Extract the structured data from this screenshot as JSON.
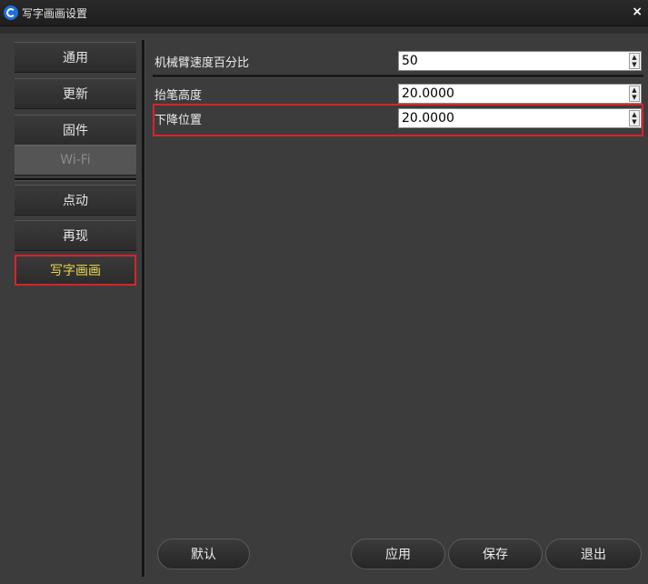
{
  "window": {
    "title": "写字画画设置",
    "close_label": "×"
  },
  "sidebar": {
    "items": [
      {
        "label": "通用",
        "state": "normal"
      },
      {
        "label": "更新",
        "state": "normal"
      },
      {
        "label": "固件",
        "state": "normal"
      },
      {
        "label": "Wi-Fi",
        "state": "disabled"
      },
      {
        "label": "点动",
        "state": "normal"
      },
      {
        "label": "再现",
        "state": "normal"
      },
      {
        "label": "写字画画",
        "state": "active"
      }
    ]
  },
  "settings": {
    "rows": [
      {
        "label": "机械臂速度百分比",
        "value": "50"
      },
      {
        "label": "抬笔高度",
        "value": "20.0000"
      },
      {
        "label": "下降位置",
        "value": "20.0000"
      }
    ]
  },
  "footer": {
    "default_label": "默认",
    "apply_label": "应用",
    "save_label": "保存",
    "exit_label": "退出"
  },
  "colors": {
    "accent_red": "#d9232a",
    "active_text": "#e8d84a",
    "background": "#3c3c3c"
  }
}
